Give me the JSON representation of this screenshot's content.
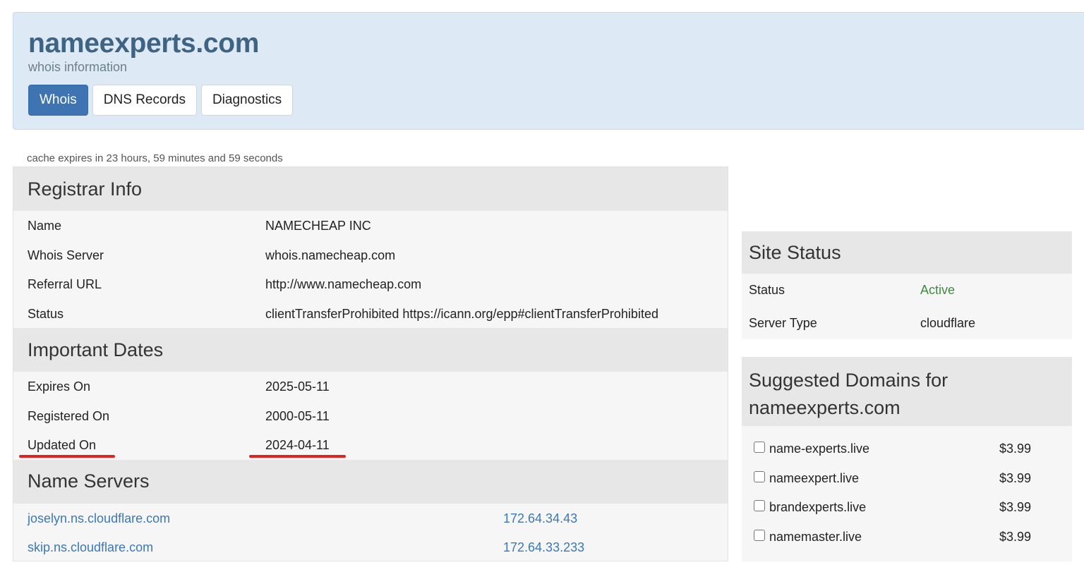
{
  "header": {
    "title": "nameexperts.com",
    "subtitle": "whois information",
    "tabs": [
      {
        "label": "Whois",
        "active": true
      },
      {
        "label": "DNS Records",
        "active": false
      },
      {
        "label": "Diagnostics",
        "active": false
      }
    ]
  },
  "cache_notice": "cache expires in 23 hours, 59 minutes and 59 seconds",
  "registrar_info": {
    "title": "Registrar Info",
    "rows": [
      {
        "label": "Name",
        "value": "NAMECHEAP INC"
      },
      {
        "label": "Whois Server",
        "value": "whois.namecheap.com"
      },
      {
        "label": "Referral URL",
        "value": "http://www.namecheap.com"
      },
      {
        "label": "Status",
        "value": "clientTransferProhibited https://icann.org/epp#clientTransferProhibited"
      }
    ]
  },
  "important_dates": {
    "title": "Important Dates",
    "rows": [
      {
        "label": "Expires On",
        "value": "2025-05-11"
      },
      {
        "label": "Registered On",
        "value": "2000-05-11"
      },
      {
        "label": "Updated On",
        "value": "2024-04-11"
      }
    ],
    "highlight_color": "#e0231f"
  },
  "name_servers": {
    "title": "Name Servers",
    "rows": [
      {
        "host": "joselyn.ns.cloudflare.com",
        "ip": "172.64.34.43"
      },
      {
        "host": "skip.ns.cloudflare.com",
        "ip": "172.64.33.233"
      }
    ]
  },
  "site_status": {
    "title": "Site Status",
    "rows": [
      {
        "label": "Status",
        "value": "Active"
      },
      {
        "label": "Server Type",
        "value": "cloudflare"
      }
    ]
  },
  "suggested": {
    "title_line1": "Suggested Domains for",
    "title_line2": "nameexperts.com",
    "items": [
      {
        "domain": "name-experts.live",
        "price": "$3.99"
      },
      {
        "domain": "nameexpert.live",
        "price": "$3.99"
      },
      {
        "domain": "brandexperts.live",
        "price": "$3.99"
      },
      {
        "domain": "namemaster.live",
        "price": "$3.99"
      }
    ]
  },
  "colors": {
    "accent": "#3f74b2",
    "link": "#3b78b8",
    "active_status": "#3e8a3e",
    "header_bg": "#dde9f4"
  }
}
